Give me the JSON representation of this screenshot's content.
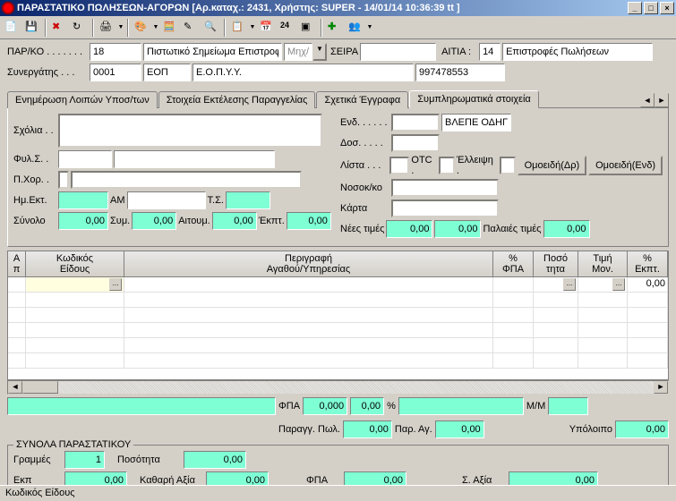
{
  "window": {
    "title": "ΠΑΡΑΣΤΑΤΙΚΟ ΠΩΛΗΣΕΩΝ-ΑΓΟΡΩΝ [Αρ.καταχ.: 2431, Χρήστης: SUPER - 14/01/14 10:36:39 tt ]"
  },
  "header": {
    "par_ko_label": "ΠΑΡ/ΚΟ . . . . . . .",
    "par_ko": "18",
    "doc_type": "Πιστωτικό Σημείωμα Επιστροφ",
    "mxv": "Μηχ/νι",
    "seira_label": "ΣΕΙΡΑ",
    "seira": "",
    "aitia_label": "ΑΙΤΙΑ :",
    "aitia": "14",
    "aitia_desc": "Επιστροφές Πωλήσεων",
    "synergatis_label": "Συνεργάτης . . .",
    "synergatis": "0001",
    "eop": "ΕΟΠ",
    "eopyy": "Ε.Ο.Π.Υ.Υ.",
    "afm": "997478553"
  },
  "tabs": {
    "t1": "Ενημέρωση Λοιπών Υποσ/των",
    "t2": "Στοιχεία Εκτέλεσης Παραγγελίας",
    "t3": "Σχετικά Έγγραφα",
    "t4": "Συμπληρωματικά στοιχεία"
  },
  "tc": {
    "sxolia_label": "Σχόλια . .",
    "fyls_label": "Φυλ.Σ. .",
    "pxor_label": "Π.Χορ. .",
    "hmekt_label": "Ημ.Εκτ.",
    "am_label": "ΑΜ",
    "ts_label": "Τ.Σ.",
    "synolo_label": "Σύνολο",
    "synolo": "0,00",
    "sym_label": "Συμ.",
    "sym": "0,00",
    "aitoum_label": "Αιτουμ.",
    "aitoum": "0,00",
    "ekpt_label": "Έκπτ.",
    "ekpt": "0,00",
    "end_label": "Ενδ. . . . . .",
    "dos_label": "Δοσ. . . . .",
    "lista_label": "Λίστα . . .",
    "nosok_label": "Νοσοκ/κο",
    "karta_label": "Κάρτα",
    "blepe": "ΒΛΕΠΕ ΟΔΗΓΙΕ",
    "otc": "OTC .",
    "elleipsi": "Έλλειψη .",
    "omoeidi_dr": "Ομοειδή(Δρ)",
    "omoeidi_end": "Ομοειδή(Ενδ)",
    "nees_label": "Νέες τιμές",
    "nees1": "0,00",
    "nees2": "0,00",
    "palies_label": "Παλαιές τιμές",
    "palies": "0,00"
  },
  "grid": {
    "cols": {
      "ap": "Α\nπ",
      "kodikos": "Κωδικός\nΕίδους",
      "perigrafi": "Περιγραφή\nΑγαθού/Υπηρεσίας",
      "fpa": "%\nΦΠΑ",
      "posot": "Ποσό\nτητα",
      "timi": "Τιμή\nΜον.",
      "ekpt": "%\nΕκπτ."
    },
    "row0": {
      "ekpt": "0,00"
    }
  },
  "footer1": {
    "fpa_label": "ΦΠΑ",
    "fpa_val": "0,000",
    "fpa_pct": "0,00",
    "pct": "%",
    "mm_label": "Μ/Μ",
    "paragg_label": "Παραγγ. Πωλ.",
    "paragg": "0,00",
    "parag_label": "Παρ. Αγ.",
    "parag": "0,00",
    "ypol_label": "Υπόλοιπο",
    "ypol": "0,00"
  },
  "totals": {
    "legend": "ΣΥΝΟΛΑ ΠΑΡΑΣΤΑΤΙΚΟΥ",
    "grammes_label": "Γραμμές",
    "grammes": "1",
    "posotita_label": "Ποσότητα",
    "posotita": "0,00",
    "ekp_label": "Εκπ",
    "ekp": "0,00",
    "katharo_label": "Καθαρή Αξία",
    "katharo": "0,00",
    "fpa_label": "ΦΠΑ",
    "fpa": "0,00",
    "saxia_label": "Σ. Αξία",
    "saxia": "0,00"
  },
  "status": "Κωδικός Είδους"
}
